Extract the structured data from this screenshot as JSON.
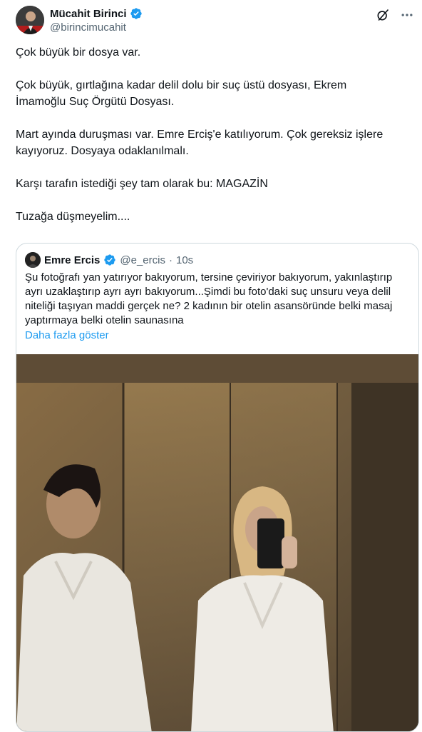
{
  "tweet": {
    "author_name": "Mücahit Birinci",
    "author_handle": "@birincimucahit",
    "verified_icon": "verified-badge-icon",
    "actions": {
      "grok_icon": "grok-icon",
      "more_icon": "more-options-icon"
    },
    "paragraphs": [
      "Çok büyük bir dosya var.",
      "Çok büyük, gırtlağına kadar delil dolu bir suç üstü dosyası, Ekrem\nİmamoğlu Suç Örgütü Dosyası.",
      "Mart ayında duruşması var. Emre Erciş'e katılıyorum. Çok gereksiz işlere\nkayıyoruz. Dosyaya odaklanılmalı.",
      "Karşı tarafın istediği şey tam olarak bu: MAGAZİN",
      "Tuzağa düşmeyelim...."
    ]
  },
  "quote": {
    "author_name": "Emre Ercis",
    "author_handle": "@e_ercis",
    "separator": "·",
    "time": "10s",
    "text": "Şu fotoğrafı yan yatırıyor bakıyorum, tersine çeviriyor bakıyorum, yakınlaştırıp ayrı uzaklaştırıp ayrı ayrı bakıyorum...Şimdi bu foto'daki suç unsuru veya delil niteliği taşıyan maddi gerçek ne? 2 kadının bir otelin asansöründe belki masaj yaptırmaya belki otelin saunasına",
    "show_more": "Daha fazla göster"
  },
  "colors": {
    "text": "#0f1419",
    "secondary": "#536471",
    "link": "#1d9bf0",
    "border": "#cfd9de",
    "verified": "#1d9bf0"
  }
}
